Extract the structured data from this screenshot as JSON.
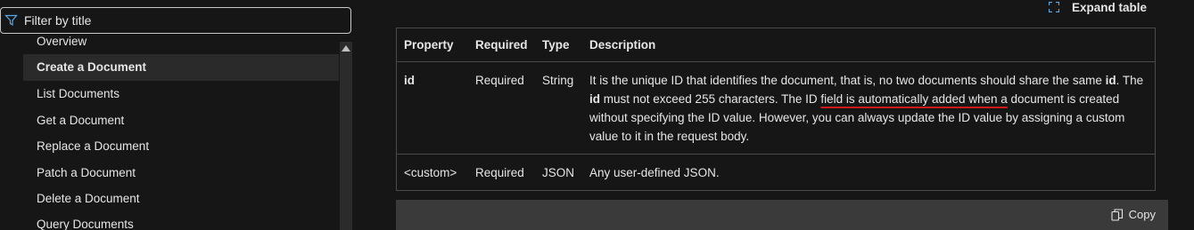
{
  "sidebar": {
    "filter": {
      "placeholder": "Filter by title",
      "value": ""
    },
    "items": [
      {
        "label": "Overview"
      },
      {
        "label": "Create a Document"
      },
      {
        "label": "List Documents"
      },
      {
        "label": "Get a Document"
      },
      {
        "label": "Replace a Document"
      },
      {
        "label": "Patch a Document"
      },
      {
        "label": "Delete a Document"
      },
      {
        "label": "Query Documents"
      }
    ],
    "active_item": "Create a Document"
  },
  "toolbar": {
    "expand_label": "Expand table"
  },
  "table": {
    "headers": [
      "Property",
      "Required",
      "Type",
      "Description"
    ],
    "rows": [
      {
        "property": "id",
        "required": "Required",
        "type": "String",
        "description": {
          "p1": "It is the unique ID that identifies the document, that is, no two documents should share the same ",
          "b1": "id",
          "p2": ". The ",
          "b2": "id",
          "p3": " must not exceed 255 characters. The ID ",
          "u1": "field is automatically added when a",
          "p4": " document is created without specifying the ID value. However, you can always update the ID value by assigning a custom value to it in the request body."
        }
      },
      {
        "property": "<custom>",
        "required": "Required",
        "type": "JSON",
        "description": {
          "text": "Any user-defined JSON."
        }
      }
    ]
  },
  "code": {
    "copy_label": "Copy"
  },
  "colors": {
    "background": "#161616",
    "text": "#e6e6e6",
    "active_bg": "#2a2a2a",
    "annotation": "#d01818"
  }
}
